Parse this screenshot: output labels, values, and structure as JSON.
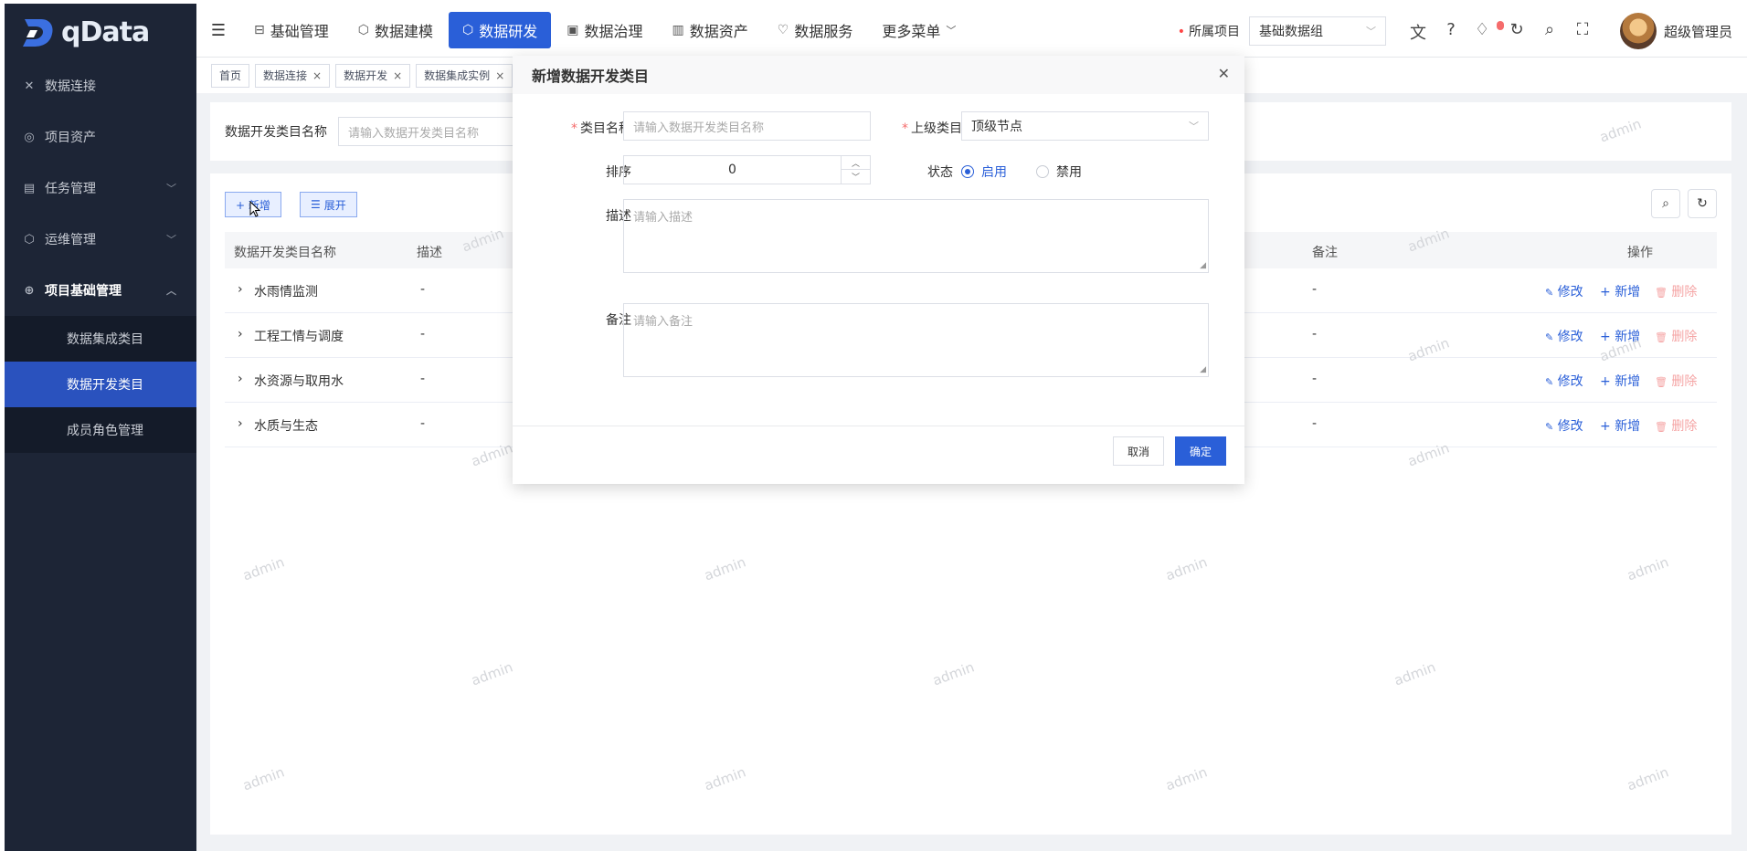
{
  "app": {
    "logo_text": "qData"
  },
  "sidebar": {
    "items": [
      {
        "label": "数据连接",
        "icon": "link-icon"
      },
      {
        "label": "项目资产",
        "icon": "asset-icon"
      },
      {
        "label": "任务管理",
        "icon": "task-icon"
      },
      {
        "label": "运维管理",
        "icon": "ops-icon"
      },
      {
        "label": "项目基础管理",
        "icon": "globe-icon"
      }
    ],
    "sub_items": [
      {
        "label": "数据集成类目"
      },
      {
        "label": "数据开发类目"
      },
      {
        "label": "成员角色管理"
      }
    ]
  },
  "topnav": {
    "items": [
      {
        "label": "基础管理"
      },
      {
        "label": "数据建模"
      },
      {
        "label": "数据研发"
      },
      {
        "label": "数据治理"
      },
      {
        "label": "数据资产"
      },
      {
        "label": "数据服务"
      },
      {
        "label": "更多菜单"
      }
    ],
    "project_label": "所属项目",
    "project_value": "基础数据组",
    "badge_count": "",
    "user_name": "超级管理员"
  },
  "tags": [
    {
      "label": "首页"
    },
    {
      "label": "数据连接"
    },
    {
      "label": "数据开发"
    },
    {
      "label": "数据集成实例"
    }
  ],
  "search": {
    "label": "数据开发类目名称",
    "placeholder": "请输入数据开发类目名称"
  },
  "toolbar": {
    "add_label": "+ 新增",
    "expand_label": "展开"
  },
  "table": {
    "headers": {
      "name": "数据开发类目名称",
      "desc": "描述",
      "remark": "备注",
      "ops": "操作"
    },
    "rows": [
      {
        "name": "水雨情监测",
        "desc": "-",
        "remark": "-"
      },
      {
        "name": "工程工情与调度",
        "desc": "-",
        "remark": "-"
      },
      {
        "name": "水资源与取用水",
        "desc": "-",
        "remark": "-"
      },
      {
        "name": "水质与生态",
        "desc": "-",
        "remark": "-"
      }
    ],
    "action_edit": "修改",
    "action_add": "新增",
    "action_delete": "删除"
  },
  "watermark": "admin",
  "modal": {
    "title": "新增数据开发类目",
    "name_label": "类目名称",
    "name_placeholder": "请输入数据开发类目名称",
    "parent_label": "上级类目",
    "parent_value": "顶级节点",
    "sort_label": "排序",
    "sort_value": "0",
    "status_label": "状态",
    "status_on": "启用",
    "status_off": "禁用",
    "desc_label": "描述",
    "desc_placeholder": "请输入描述",
    "remark_label": "备注",
    "remark_placeholder": "请输入备注",
    "cancel": "取消",
    "confirm": "确定"
  },
  "colors": {
    "primary": "#2a5fd8",
    "sidebar_bg": "#1d2536",
    "danger": "#f56c6c"
  }
}
